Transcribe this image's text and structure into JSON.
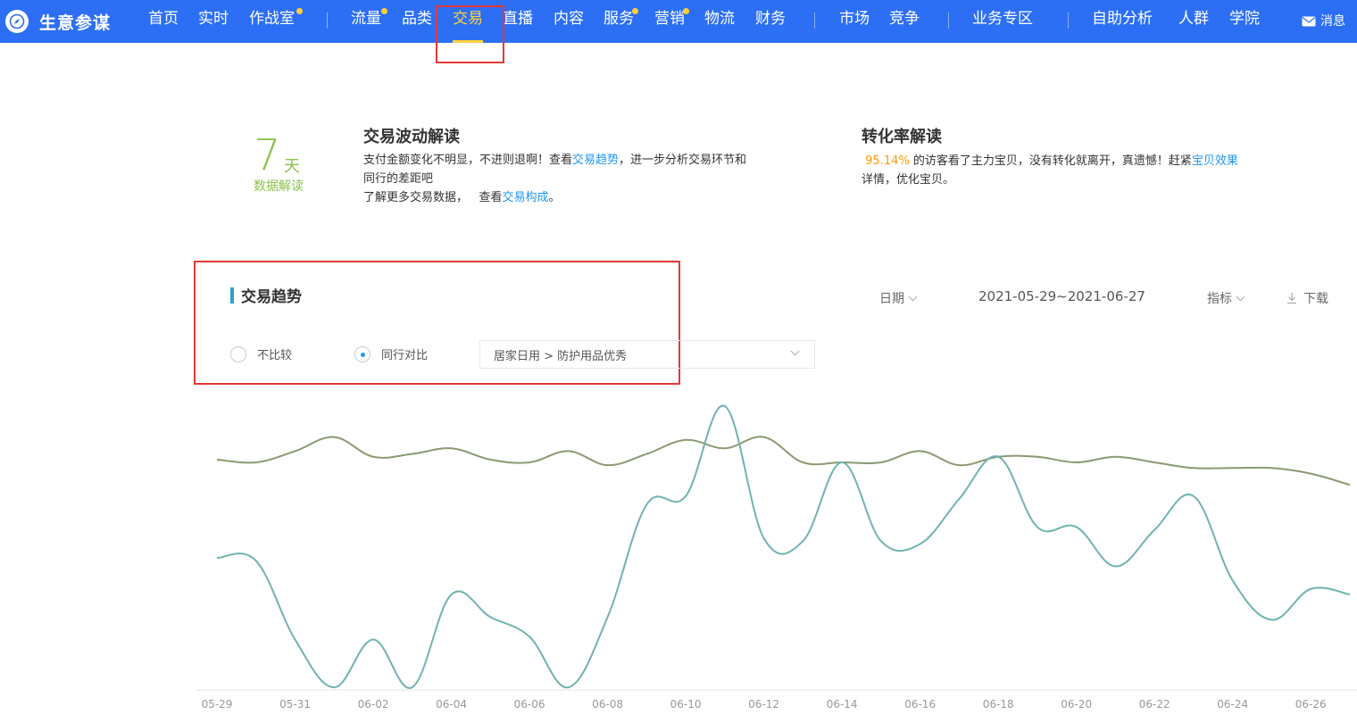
{
  "brand": {
    "name": "生意参谋"
  },
  "nav": {
    "items": [
      {
        "label": "首页"
      },
      {
        "label": "实时"
      },
      {
        "label": "作战室"
      },
      {
        "label": "流量"
      },
      {
        "label": "品类"
      },
      {
        "label": "交易",
        "active": true
      },
      {
        "label": "直播"
      },
      {
        "label": "内容"
      },
      {
        "label": "服务"
      },
      {
        "label": "营销"
      },
      {
        "label": "物流"
      },
      {
        "label": "财务"
      },
      {
        "label": "市场"
      },
      {
        "label": "竞争"
      },
      {
        "label": "业务专区"
      },
      {
        "label": "自助分析"
      },
      {
        "label": "人群"
      },
      {
        "label": "学院"
      }
    ],
    "message": "消息",
    "accent": "#2c6ff5",
    "active_color": "#ffd23c"
  },
  "days_badge": {
    "number": "7",
    "unit": "天",
    "label": "数据解读"
  },
  "insight_trade": {
    "title": "交易波动解读",
    "text1": "支付金额变化不明显，不进则退啊！查看",
    "link1": "交易趋势",
    "text2": "，进一步分析交易环节和",
    "text3": "同行的差距吧",
    "text4": "了解更多交易数据，",
    "text5": "查看",
    "link2": "交易构成",
    "text6": "。"
  },
  "insight_conversion": {
    "title": "转化率解读",
    "rate": "95.14%",
    "text1": " 的访客看了主力宝贝，没有转化就离开，真遗憾！赶紧",
    "link1": "宝贝效果",
    "text2": "详情，优化宝贝。"
  },
  "trend": {
    "title": "交易趋势",
    "date_filter": "日期",
    "date_range": "2021-05-29~2021-06-27",
    "metric_filter": "指标",
    "download": "下载",
    "compare_none": "不比较",
    "compare_peer": "同行对比",
    "category": "居家日用 > 防护用品优秀"
  },
  "chart_data": {
    "type": "line",
    "x": [
      "05-29",
      "05-30",
      "05-31",
      "06-01",
      "06-02",
      "06-03",
      "06-04",
      "06-05",
      "06-06",
      "06-07",
      "06-08",
      "06-09",
      "06-10",
      "06-11",
      "06-12",
      "06-13",
      "06-14",
      "06-15",
      "06-16",
      "06-17",
      "06-18",
      "06-19",
      "06-20",
      "06-21",
      "06-22",
      "06-23",
      "06-24",
      "06-25",
      "06-26",
      "06-27"
    ],
    "x_tick_labels": [
      "05-29",
      "05-31",
      "06-02",
      "06-04",
      "06-06",
      "06-08",
      "06-10",
      "06-12",
      "06-14",
      "06-16",
      "06-18",
      "06-20",
      "06-22",
      "06-24",
      "06-26"
    ],
    "ylim": [
      0,
      100
    ],
    "series": [
      {
        "color": "#8a9a72",
        "values": [
          81,
          80,
          84,
          89,
          82,
          83,
          85,
          81,
          80,
          84,
          79,
          83,
          88,
          85,
          89,
          80,
          80,
          80,
          84,
          79,
          82,
          82,
          80,
          82,
          80,
          78,
          78,
          78,
          76,
          72
        ]
      },
      {
        "color": "#6fb3b0",
        "values": [
          46,
          45,
          17,
          0,
          17,
          0,
          33,
          25,
          18,
          0,
          25,
          65,
          68,
          100,
          53,
          52,
          80,
          52,
          51,
          67,
          82,
          57,
          57,
          43,
          56,
          68,
          38,
          24,
          35,
          33
        ]
      }
    ],
    "grid": false,
    "legend": "none"
  }
}
